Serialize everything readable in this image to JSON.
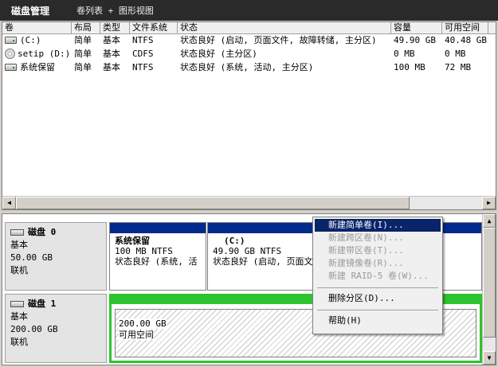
{
  "window": {
    "title": "磁盘管理",
    "subtitle": "卷列表 + 图形视图"
  },
  "volume_table": {
    "columns": [
      "卷",
      "布局",
      "类型",
      "文件系统",
      "状态",
      "容量",
      "可用空间"
    ],
    "rows": [
      {
        "icon": "drive-icon",
        "cells": [
          "(C:)",
          "简单",
          "基本",
          "NTFS",
          "状态良好 (启动, 页面文件, 故障转储, 主分区)",
          "49.90 GB",
          "40.48 GB"
        ]
      },
      {
        "icon": "cd-icon",
        "cells": [
          "setip (D:)",
          "简单",
          "基本",
          "CDFS",
          "状态良好 (主分区)",
          "0 MB",
          "0 MB"
        ]
      },
      {
        "icon": "drive-icon",
        "cells": [
          "系统保留",
          "简单",
          "基本",
          "NTFS",
          "状态良好 (系统, 活动, 主分区)",
          "100 MB",
          "72 MB"
        ]
      }
    ]
  },
  "disks": [
    {
      "name": "磁盘 0",
      "type": "基本",
      "size": "50.00 GB",
      "status": "联机",
      "partitions": [
        {
          "name": "系统保留",
          "size_fs": "100 MB NTFS",
          "status": "状态良好 (系统, 活"
        },
        {
          "name": "(C:)",
          "size_fs": "49.90 GB NTFS",
          "status": "状态良好 (启动, 页面文"
        }
      ]
    },
    {
      "name": "磁盘 1",
      "type": "基本",
      "size": "200.00 GB",
      "status": "联机",
      "unallocated": {
        "size": "200.00 GB",
        "label": "可用空间"
      }
    }
  ],
  "context_menu": {
    "items": [
      {
        "label": "新建简单卷(I)...",
        "state": "selected"
      },
      {
        "label": "新建跨区卷(N)...",
        "state": "disabled"
      },
      {
        "label": "新建带区卷(T)...",
        "state": "disabled"
      },
      {
        "label": "新建镜像卷(R)...",
        "state": "disabled"
      },
      {
        "label": "新建 RAID-5 卷(W)...",
        "state": "disabled"
      },
      {
        "label": "删除分区(D)...",
        "state": "enabled"
      },
      {
        "label": "帮助(H)",
        "state": "enabled"
      }
    ]
  },
  "colors": {
    "primary_partition": "#002b8c",
    "unallocated": "#2ec32e",
    "menu_highlight": "#0a246a"
  }
}
